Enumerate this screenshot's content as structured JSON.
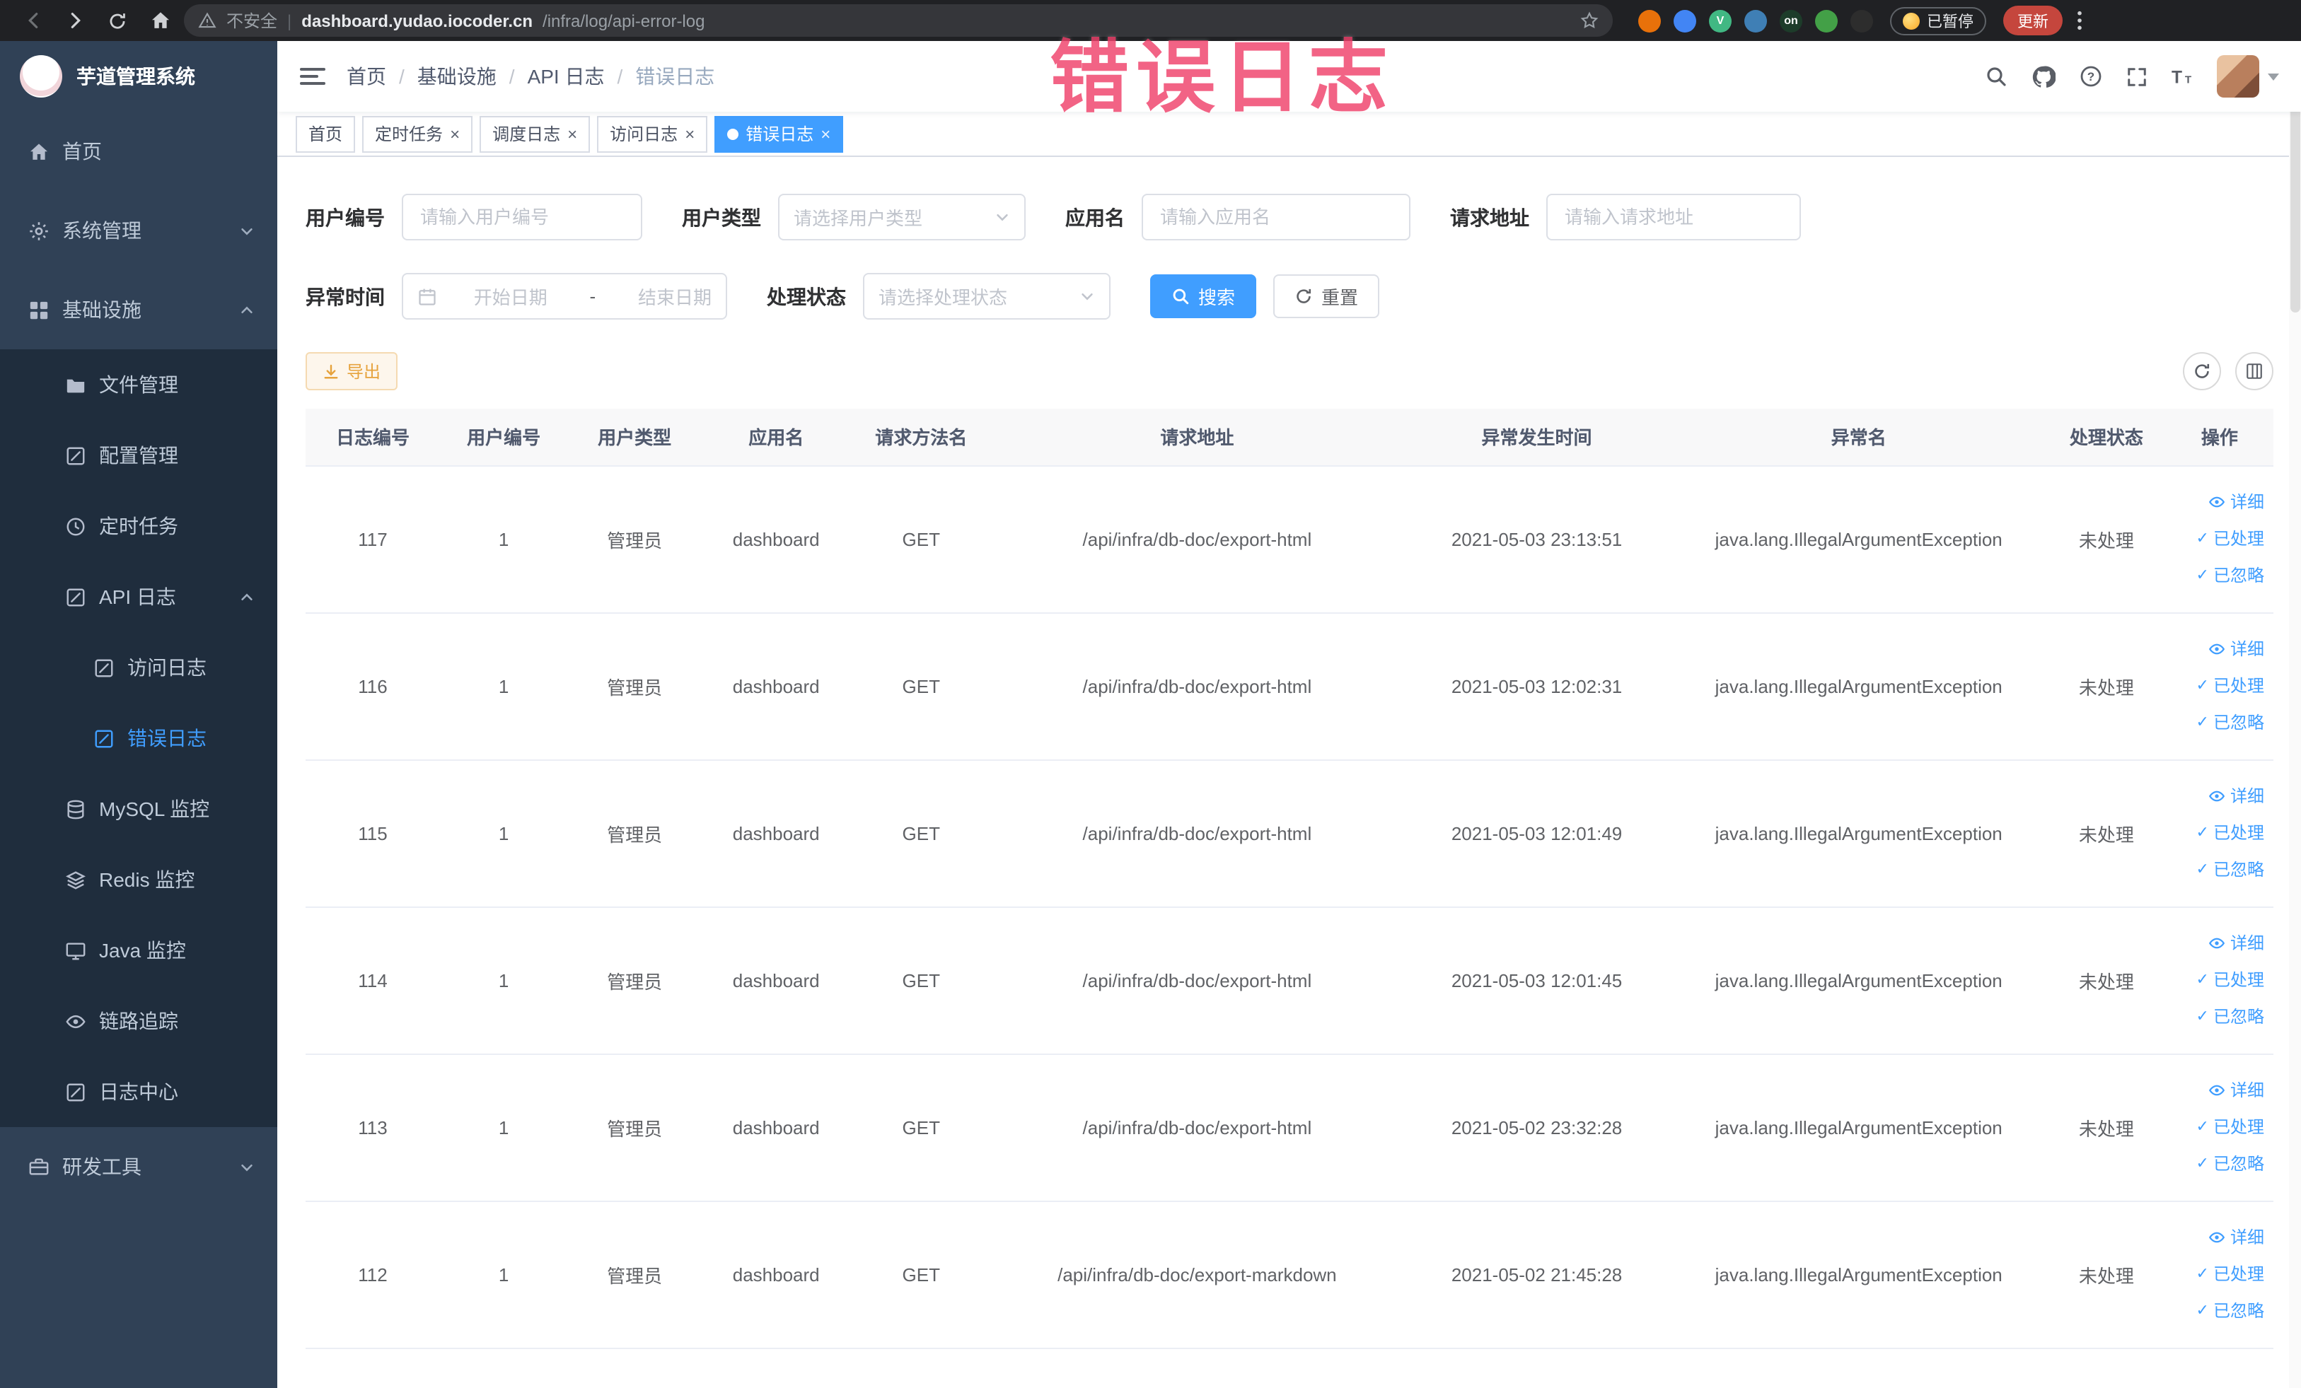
{
  "theme": {
    "accent": "#409eff",
    "sidebar_bg": "#304156",
    "sidebar_submenu_bg": "#1f2d3d",
    "warning": "#e6a23c",
    "annotation": "#f0416b"
  },
  "overlay_annotation": {
    "text": "错误日志"
  },
  "browser": {
    "security_label": "不安全",
    "url_domain": "dashboard.yudao.iocoder.cn",
    "url_path": "/infra/log/api-error-log",
    "paused_badge": "已暂停",
    "update_button": "更新",
    "extension_icons": [
      {
        "name": "extension-orange",
        "color": "#e8710a",
        "letter": ""
      },
      {
        "name": "extension-blue-dot",
        "color": "#4285f4",
        "letter": ""
      },
      {
        "name": "extension-vue-devtools",
        "color": "#41b883",
        "letter": "V"
      },
      {
        "name": "extension-grid",
        "color": "#3f7fb5",
        "letter": ""
      },
      {
        "name": "extension-switch-on",
        "color": "#1d3c2a",
        "letter": "on"
      },
      {
        "name": "extension-leaf",
        "color": "#43a047",
        "letter": ""
      },
      {
        "name": "extension-dark",
        "color": "#2d2d2d",
        "letter": ""
      }
    ]
  },
  "sidebar": {
    "app_title": "芋道管理系统",
    "items": [
      {
        "label": "首页",
        "icon": "home",
        "depth": 1
      },
      {
        "label": "系统管理",
        "icon": "gear",
        "depth": 1,
        "chevron": "down"
      },
      {
        "label": "基础设施",
        "icon": "grid",
        "depth": 1,
        "chevron": "up"
      },
      {
        "label": "文件管理",
        "icon": "folder",
        "depth": 2
      },
      {
        "label": "配置管理",
        "icon": "edit",
        "depth": 2
      },
      {
        "label": "定时任务",
        "icon": "clock",
        "depth": 2
      },
      {
        "label": "API 日志",
        "icon": "edit",
        "depth": 2,
        "chevron": "up"
      },
      {
        "label": "访问日志",
        "icon": "edit",
        "depth": 3
      },
      {
        "label": "错误日志",
        "icon": "edit",
        "depth": 3,
        "active": true
      },
      {
        "label": "MySQL 监控",
        "icon": "database",
        "depth": 2
      },
      {
        "label": "Redis 监控",
        "icon": "layers",
        "depth": 2
      },
      {
        "label": "Java 监控",
        "icon": "monitor",
        "depth": 2
      },
      {
        "label": "链路追踪",
        "icon": "eye",
        "depth": 2
      },
      {
        "label": "日志中心",
        "icon": "edit",
        "depth": 2
      },
      {
        "label": "研发工具",
        "icon": "briefcase",
        "depth": 1,
        "chevron": "down"
      }
    ]
  },
  "header": {
    "breadcrumb": [
      "首页",
      "基础设施",
      "API 日志",
      "错误日志"
    ],
    "icons": [
      "search",
      "github",
      "help",
      "fullscreen",
      "font-size"
    ]
  },
  "tabs": [
    {
      "label": "首页",
      "closable": false,
      "active": false
    },
    {
      "label": "定时任务",
      "closable": true,
      "active": false
    },
    {
      "label": "调度日志",
      "closable": true,
      "active": false
    },
    {
      "label": "访问日志",
      "closable": true,
      "active": false
    },
    {
      "label": "错误日志",
      "closable": true,
      "active": true
    }
  ],
  "filters": {
    "user_id": {
      "label": "用户编号",
      "placeholder": "请输入用户编号"
    },
    "user_type": {
      "label": "用户类型",
      "placeholder": "请选择用户类型"
    },
    "app_name": {
      "label": "应用名",
      "placeholder": "请输入应用名"
    },
    "request_url": {
      "label": "请求地址",
      "placeholder": "请输入请求地址"
    },
    "exception_time": {
      "label": "异常时间",
      "start_placeholder": "开始日期",
      "separator": "-",
      "end_placeholder": "结束日期"
    },
    "process_status": {
      "label": "处理状态",
      "placeholder": "请选择处理状态"
    },
    "search_button": "搜索",
    "reset_button": "重置"
  },
  "toolbar": {
    "export_button": "导出"
  },
  "table": {
    "columns": [
      "日志编号",
      "用户编号",
      "用户类型",
      "应用名",
      "请求方法名",
      "请求地址",
      "异常发生时间",
      "异常名",
      "处理状态",
      "操作"
    ],
    "actions": [
      {
        "label": "详细",
        "icon": "eye-small",
        "name": "detail"
      },
      {
        "label": "已处理",
        "icon": "check",
        "name": "processed"
      },
      {
        "label": "已忽略",
        "icon": "check",
        "name": "ignored"
      }
    ],
    "rows": [
      {
        "id": "117",
        "user_id": "1",
        "user_type": "管理员",
        "app": "dashboard",
        "method": "GET",
        "url": "/api/infra/db-doc/export-html",
        "time": "2021-05-03 23:13:51",
        "exception": "java.lang.IllegalArgumentException",
        "status": "未处理"
      },
      {
        "id": "116",
        "user_id": "1",
        "user_type": "管理员",
        "app": "dashboard",
        "method": "GET",
        "url": "/api/infra/db-doc/export-html",
        "time": "2021-05-03 12:02:31",
        "exception": "java.lang.IllegalArgumentException",
        "status": "未处理"
      },
      {
        "id": "115",
        "user_id": "1",
        "user_type": "管理员",
        "app": "dashboard",
        "method": "GET",
        "url": "/api/infra/db-doc/export-html",
        "time": "2021-05-03 12:01:49",
        "exception": "java.lang.IllegalArgumentException",
        "status": "未处理"
      },
      {
        "id": "114",
        "user_id": "1",
        "user_type": "管理员",
        "app": "dashboard",
        "method": "GET",
        "url": "/api/infra/db-doc/export-html",
        "time": "2021-05-03 12:01:45",
        "exception": "java.lang.IllegalArgumentException",
        "status": "未处理"
      },
      {
        "id": "113",
        "user_id": "1",
        "user_type": "管理员",
        "app": "dashboard",
        "method": "GET",
        "url": "/api/infra/db-doc/export-html",
        "time": "2021-05-02 23:32:28",
        "exception": "java.lang.IllegalArgumentException",
        "status": "未处理"
      },
      {
        "id": "112",
        "user_id": "1",
        "user_type": "管理员",
        "app": "dashboard",
        "method": "GET",
        "url": "/api/infra/db-doc/export-markdown",
        "time": "2021-05-02 21:45:28",
        "exception": "java.lang.IllegalArgumentException",
        "status": "未处理"
      }
    ]
  }
}
